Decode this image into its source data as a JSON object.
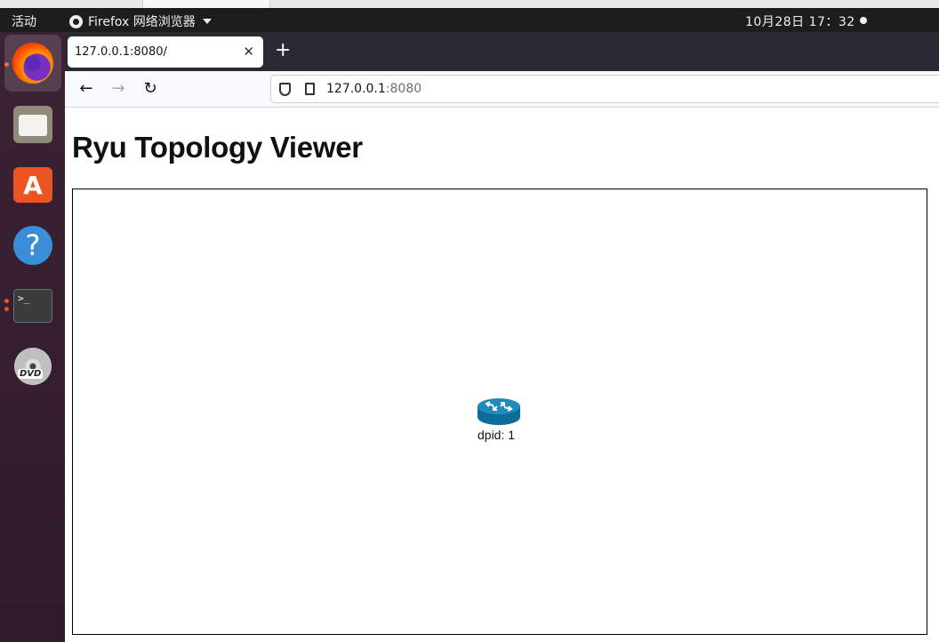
{
  "panel": {
    "activities": "活动",
    "app_name": "Firefox 网络浏览器",
    "clock": "10月28日  17：32"
  },
  "browser": {
    "tab_title": "127.0.0.1:8080/",
    "url_host": "127.0.0.1",
    "url_port": ":8080"
  },
  "page": {
    "title": "Ryu Topology Viewer",
    "switch_label": "dpid: 1"
  },
  "colors": {
    "switch_icon": "#0b6d98",
    "panel_bg": "#1d1d1d",
    "dock_bg": "#3b2234",
    "accent": "#e95420"
  },
  "icons": [
    "firefox-icon",
    "files-icon",
    "software-store-icon",
    "help-icon",
    "terminal-icon",
    "dvd-icon",
    "router-icon"
  ]
}
